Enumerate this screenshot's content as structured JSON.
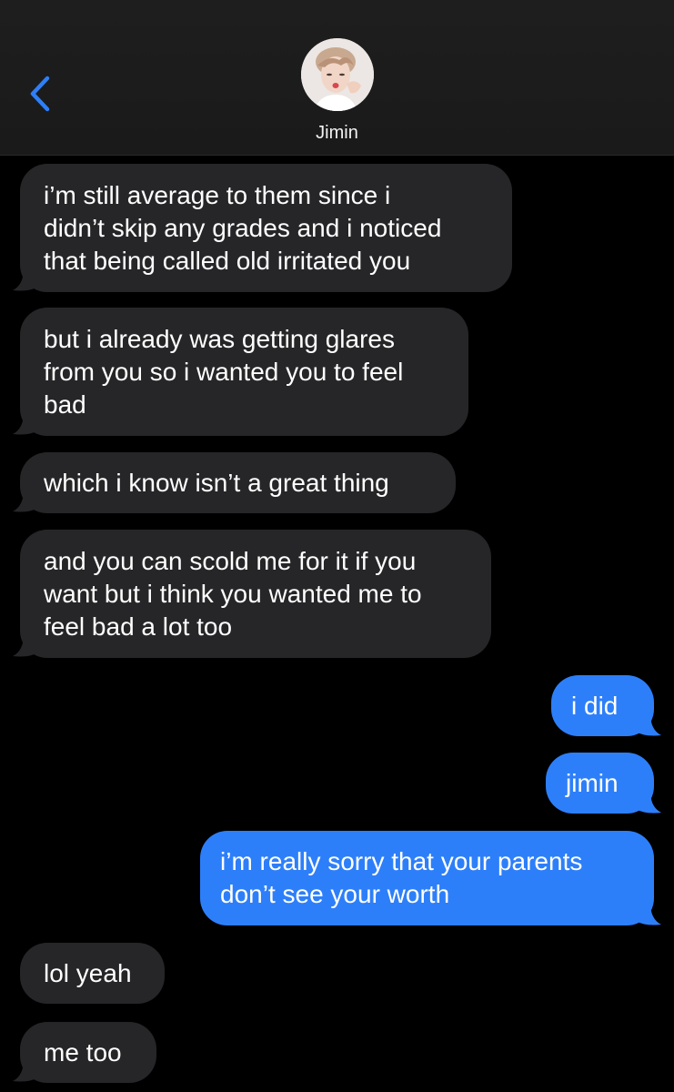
{
  "header": {
    "contact_name": "Jimin",
    "back_icon": "chevron-left-icon",
    "accent_color": "#2d7ff9"
  },
  "messages": [
    {
      "direction": "in",
      "text": "i’m still average to them since i\ndidn’t skip any grades and i noticed\nthat being called old irritated you"
    },
    {
      "direction": "in",
      "text": "but i already was getting glares\nfrom you so i wanted you to feel\nbad"
    },
    {
      "direction": "in",
      "text": "which i know isn’t a great thing"
    },
    {
      "direction": "in",
      "text": "and you can scold me for it if you\nwant but i think you wanted me to\nfeel bad a lot too"
    },
    {
      "direction": "out",
      "text": "i did"
    },
    {
      "direction": "out",
      "text": "jimin"
    },
    {
      "direction": "out",
      "text": "i’m really sorry that your parents\ndon’t see your worth"
    },
    {
      "direction": "in",
      "text": "lol yeah"
    },
    {
      "direction": "in",
      "text": "me too"
    }
  ]
}
